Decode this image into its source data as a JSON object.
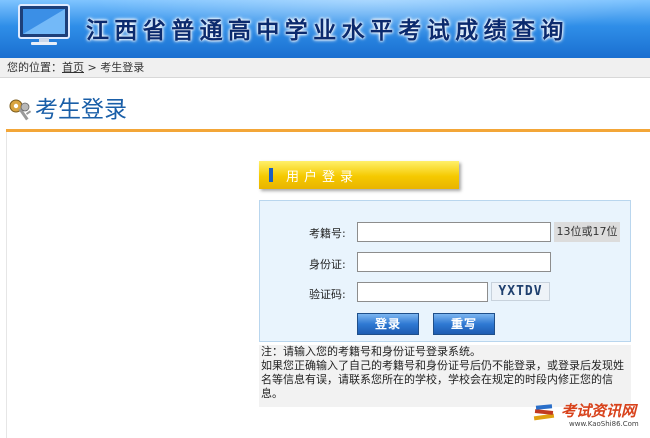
{
  "header": {
    "site_title": "江西省普通高中学业水平考试成绩查询"
  },
  "breadcrumb": {
    "prefix": "您的位置：",
    "home": "首页",
    "separator": " > ",
    "current": "考生登录"
  },
  "page": {
    "title": "考生登录"
  },
  "login": {
    "panel_title": "用户登录",
    "exam_no_label": "考籍号:",
    "exam_no_value": "",
    "exam_no_hint": "13位或17位",
    "id_label": "身份证:",
    "id_value": "",
    "code_label": "验证码:",
    "code_value": "",
    "captcha_text": "YXTDV",
    "login_button": "登录",
    "reset_button": "重写"
  },
  "notes": {
    "line1": "注：请输入您的考籍号和身份证号登录系统。",
    "line2": "如果您正确输入了自己的考籍号和身份证号后仍不能登录，或登录后发现姓名等信息有误，请联系您所在的学校，学校会在规定的时段内修正您的信息。"
  },
  "watermark": {
    "brand": "考试资讯网",
    "url": "www.KaoShi86.Com"
  },
  "colors": {
    "banner": "#2f8ee8",
    "title_blue": "#1a5fa8",
    "orange_rule": "#f3a638",
    "panel_yellow": "#f5c900",
    "login_bg": "#e9f4fd",
    "button_blue": "#2f79d3"
  }
}
